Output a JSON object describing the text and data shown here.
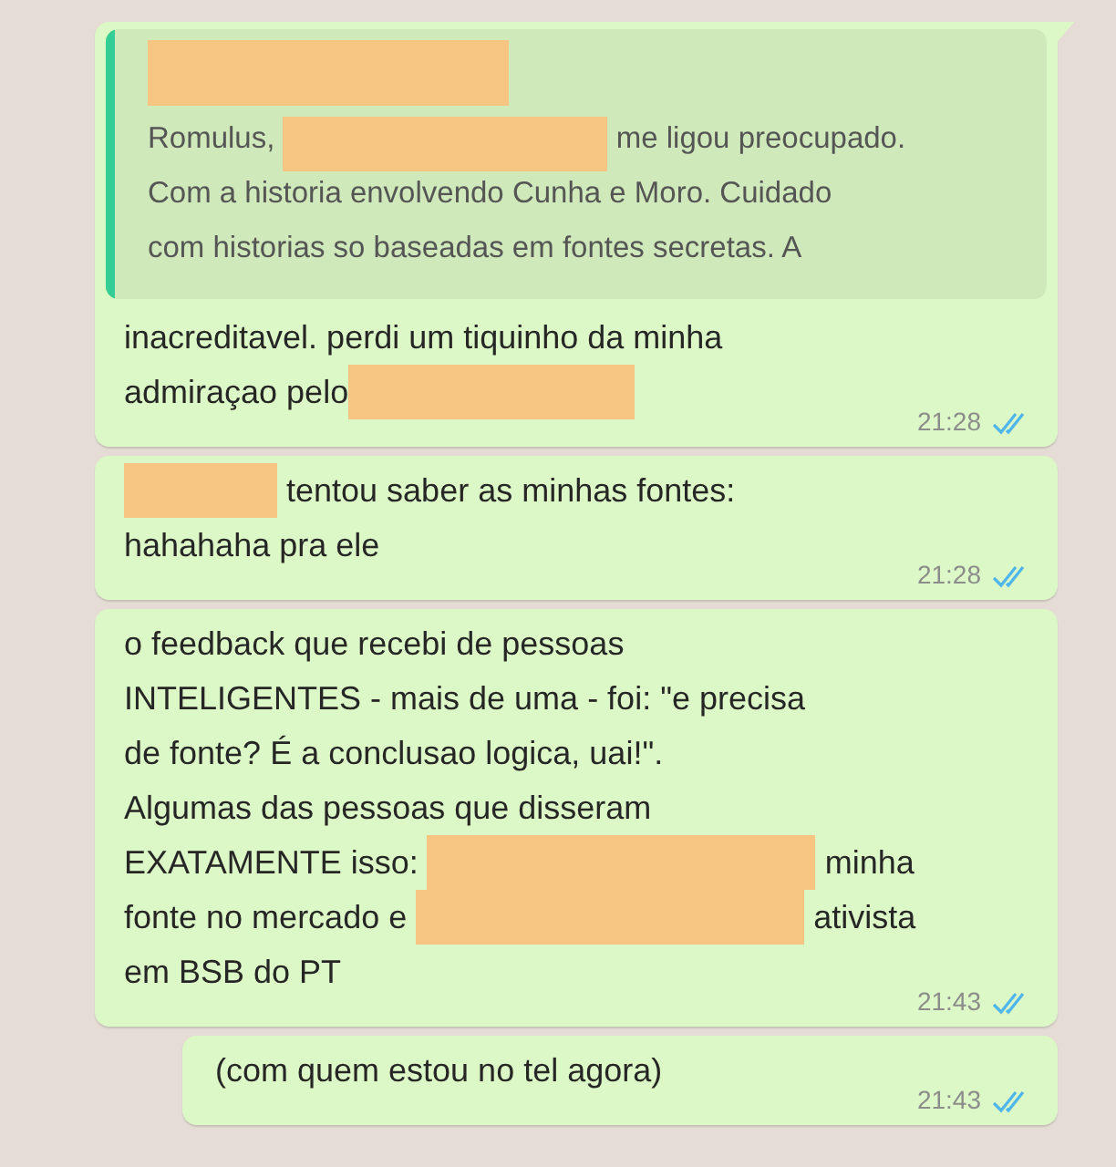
{
  "messages": [
    {
      "quote": {
        "lines": [
          [
            {
              "kind": "redacted"
            }
          ],
          [
            {
              "kind": "text",
              "text": "Romulus, "
            },
            {
              "kind": "redacted"
            },
            {
              "kind": "text",
              "text": " me ligou preocupado."
            }
          ],
          [
            {
              "kind": "text",
              "text": "Com a historia envolvendo Cunha e Moro. Cuidado"
            }
          ],
          [
            {
              "kind": "text",
              "text": "com historias so baseadas em fontes secretas. A"
            }
          ]
        ]
      },
      "lines": [
        [
          {
            "kind": "text",
            "text": "inacreditavel. perdi um tiquinho da minha"
          }
        ],
        [
          {
            "kind": "text",
            "text": "admiraçao pelo"
          },
          {
            "kind": "redacted"
          }
        ]
      ],
      "time": "21:28",
      "read": true,
      "tail": true,
      "indent": false
    },
    {
      "lines": [
        [
          {
            "kind": "redacted"
          },
          {
            "kind": "text",
            "text": " tentou saber as minhas fontes:"
          }
        ],
        [
          {
            "kind": "text",
            "text": "hahahaha pra ele"
          }
        ]
      ],
      "time": "21:28",
      "read": true,
      "tail": false,
      "indent": false
    },
    {
      "lines": [
        [
          {
            "kind": "text",
            "text": "o feedback que recebi de pessoas"
          }
        ],
        [
          {
            "kind": "text",
            "text": "INTELIGENTES - mais de uma - foi: \"e precisa"
          }
        ],
        [
          {
            "kind": "text",
            "text": "de fonte? É a conclusao logica, uai!\"."
          }
        ],
        [
          {
            "kind": "text",
            "text": "Algumas das pessoas que disseram"
          }
        ],
        [
          {
            "kind": "text",
            "text": "EXATAMENTE isso: "
          },
          {
            "kind": "redacted"
          },
          {
            "kind": "text",
            "text": " minha"
          }
        ],
        [
          {
            "kind": "text",
            "text": "fonte no mercado e "
          },
          {
            "kind": "redacted"
          },
          {
            "kind": "text",
            "text": " ativista"
          }
        ],
        [
          {
            "kind": "text",
            "text": "em BSB do PT"
          }
        ]
      ],
      "time": "21:43",
      "read": true,
      "tail": false,
      "indent": false
    },
    {
      "lines": [
        [
          {
            "kind": "text",
            "text": "(com quem estou no tel agora)"
          }
        ]
      ],
      "time": "21:43",
      "read": true,
      "tail": false,
      "indent": true
    }
  ]
}
